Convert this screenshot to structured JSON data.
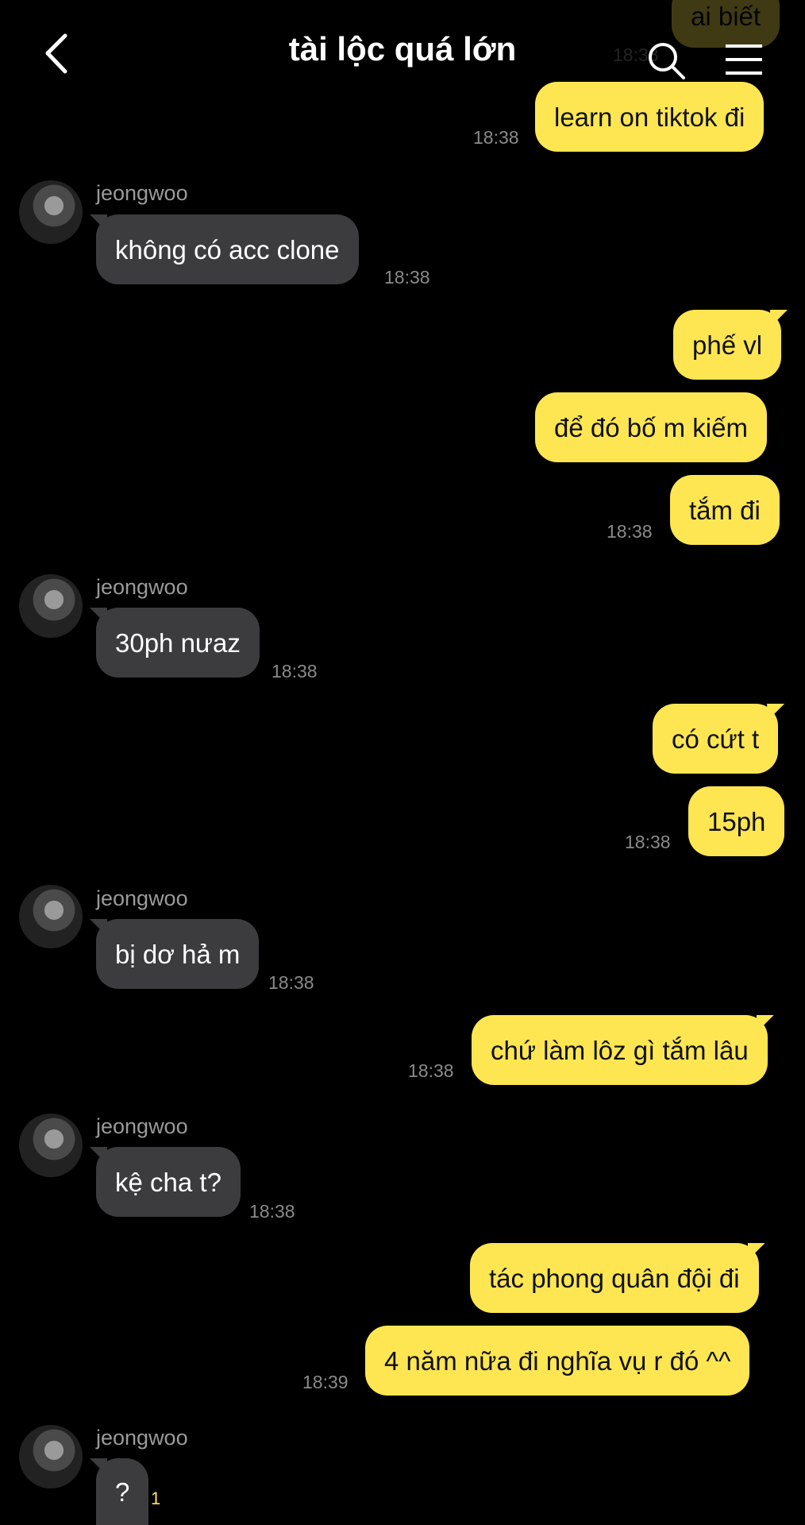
{
  "header": {
    "title": "tài lộc quá lớn",
    "back": "back-icon",
    "search": "search-icon",
    "menu": "menu-icon"
  },
  "partial_top": {
    "text": "ai biết",
    "time": "18:38"
  },
  "messages": [
    {
      "text": "learn on tiktok đi",
      "time": "18:38"
    },
    {
      "name": "jeongwoo",
      "text": "không có acc clone",
      "time": "18:38"
    },
    {
      "text": "phế vl"
    },
    {
      "text": "để đó bố m kiếm"
    },
    {
      "text": "tắm đi",
      "time": "18:38"
    },
    {
      "name": "jeongwoo",
      "text": "30ph nưaz",
      "time": "18:38"
    },
    {
      "text": "có cứt t"
    },
    {
      "text": "15ph",
      "time": "18:38"
    },
    {
      "name": "jeongwoo",
      "text": "bị dơ hả m",
      "time": "18:38"
    },
    {
      "text": "chứ làm lôz gì tắm lâu",
      "time": "18:38"
    },
    {
      "name": "jeongwoo",
      "text": "kệ cha t?",
      "time": "18:38"
    },
    {
      "text": "tác phong quân đội đi"
    },
    {
      "text": "4 năm nữa đi nghĩa vụ r đó ^^",
      "time": "18:39"
    },
    {
      "name": "jeongwoo",
      "text": "?",
      "unread": "1"
    }
  ],
  "colors": {
    "me_bubble": "#fee652",
    "other_bubble": "#3c3c3e",
    "background": "#000000"
  }
}
